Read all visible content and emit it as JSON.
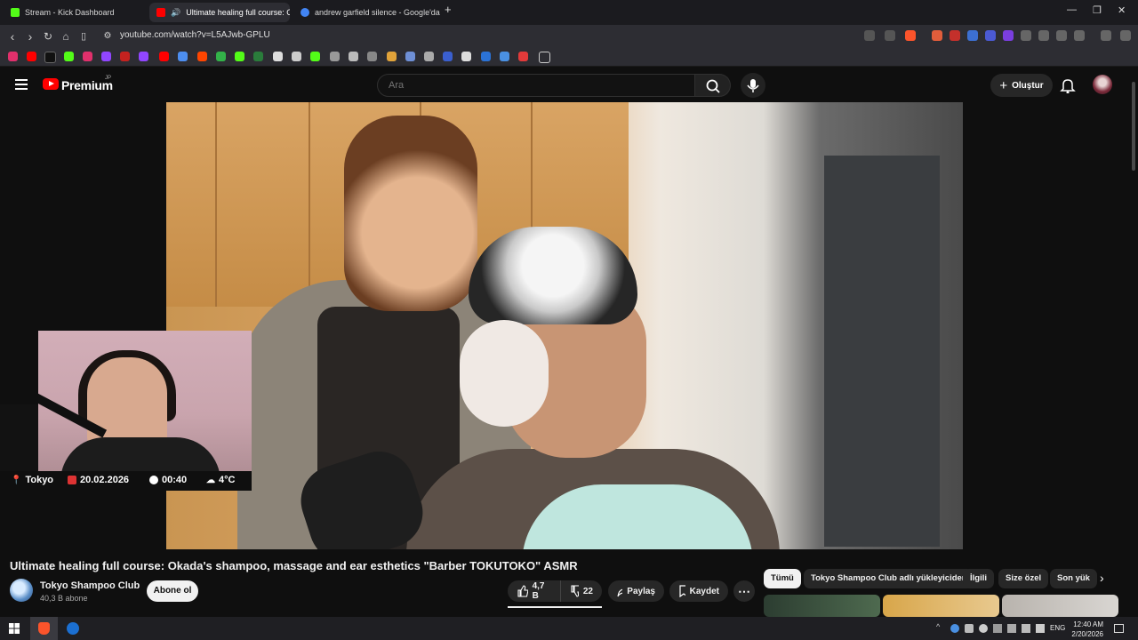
{
  "browser": {
    "tabs": [
      {
        "label": "Stream - Kick Dashboard",
        "favicon_color": "#53fc18"
      },
      {
        "label": "Ultimate healing full course: C",
        "favicon_color": "#ff0000"
      },
      {
        "label": "andrew garfield silence - Google'da a",
        "favicon_color": "#4285f4"
      }
    ],
    "url": "youtube.com/watch?v=L5AJwb-GPLU"
  },
  "youtube": {
    "logo_text": "Premium",
    "logo_sup": "JP",
    "search_placeholder": "Ara",
    "create_label": "Oluştur"
  },
  "overlay": {
    "location": "Tokyo",
    "date": "20.02.2026",
    "time": "00:40",
    "weather": "4°C"
  },
  "video": {
    "title": "Ultimate healing full course: Okada's shampoo, massage and ear esthetics \"Barber TOKUTOKO\" ASMR",
    "channel_name": "Tokyo Shampoo Club",
    "subscribers": "40,3 B abone",
    "subscribe_label": "Abone ol",
    "likes": "4,7 B",
    "dislikes": "22",
    "share_label": "Paylaş",
    "save_label": "Kaydet"
  },
  "chips": [
    "Tümü",
    "Tokyo Shampoo Club adlı yükleyiciden",
    "İlgili",
    "Size özel",
    "Son yük"
  ],
  "taskbar": {
    "language": "ENG",
    "time": "12:40 AM",
    "date": "2/20/2026"
  }
}
